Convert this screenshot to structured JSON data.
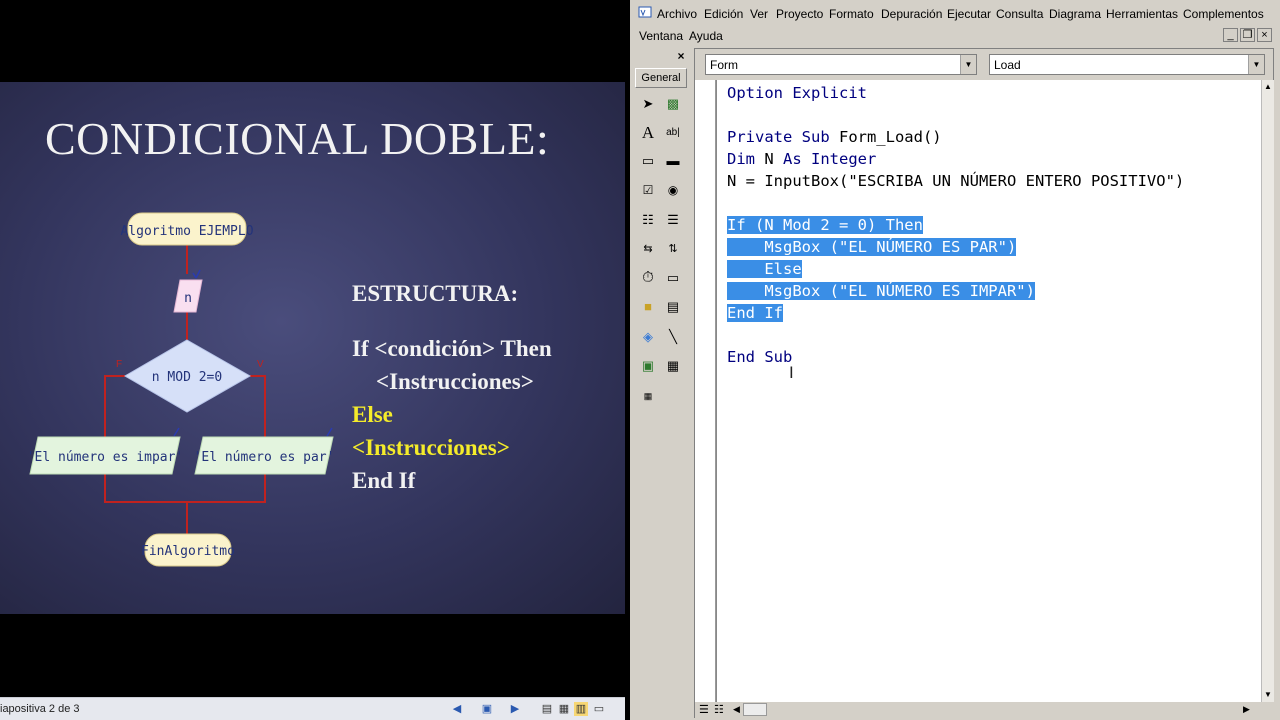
{
  "slideshow": {
    "title": "CONDICIONAL DOBLE:",
    "flowchart": {
      "start": "Algoritmo EJEMPLO",
      "input": "n",
      "condition": "n MOD 2=0",
      "false_output": "'El número es impar'",
      "true_output": "'El número es par'",
      "end": "FinAlgoritmo"
    },
    "structure": {
      "heading": "ESTRUCTURA:",
      "line1": "If <condición> Then",
      "line2": "<Instrucciones>",
      "line3": "Else",
      "line4": "<Instrucciones>",
      "line5": "End If"
    },
    "status": "iapositiva 2 de 3"
  },
  "ide": {
    "menu": [
      "Archivo",
      "Edición",
      "Ver",
      "Proyecto",
      "Formato",
      "Depuración",
      "Ejecutar",
      "Consulta",
      "Diagrama",
      "Herramientas",
      "Complementos"
    ],
    "menu2": [
      "Ventana",
      "Ayuda"
    ],
    "toolbox": {
      "close_label": "×",
      "tab": "General"
    },
    "object_combo": "Form",
    "procedure_combo": "Load",
    "code_lines": [
      {
        "text": "Option Explicit"
      },
      {
        "text": ""
      },
      {
        "text": "Private Sub Form_Load()"
      },
      {
        "text": "Dim N As Integer"
      },
      {
        "text": "N = InputBox(\"ESCRIBA UN NÚMERO ENTERO POSITIVO\")"
      },
      {
        "text": ""
      },
      {
        "text": "If (N Mod 2 = 0) Then"
      },
      {
        "text": "    MsgBox (\"EL NÚMERO ES PAR\")"
      },
      {
        "text": "    Else"
      },
      {
        "text": "    MsgBox (\"EL NÚMERO ES IMPAR\")"
      },
      {
        "text": "End If"
      },
      {
        "text": ""
      },
      {
        "text": "End Sub"
      }
    ],
    "selection_color": "#3a8ee6",
    "keyword_color": "#00007f"
  }
}
